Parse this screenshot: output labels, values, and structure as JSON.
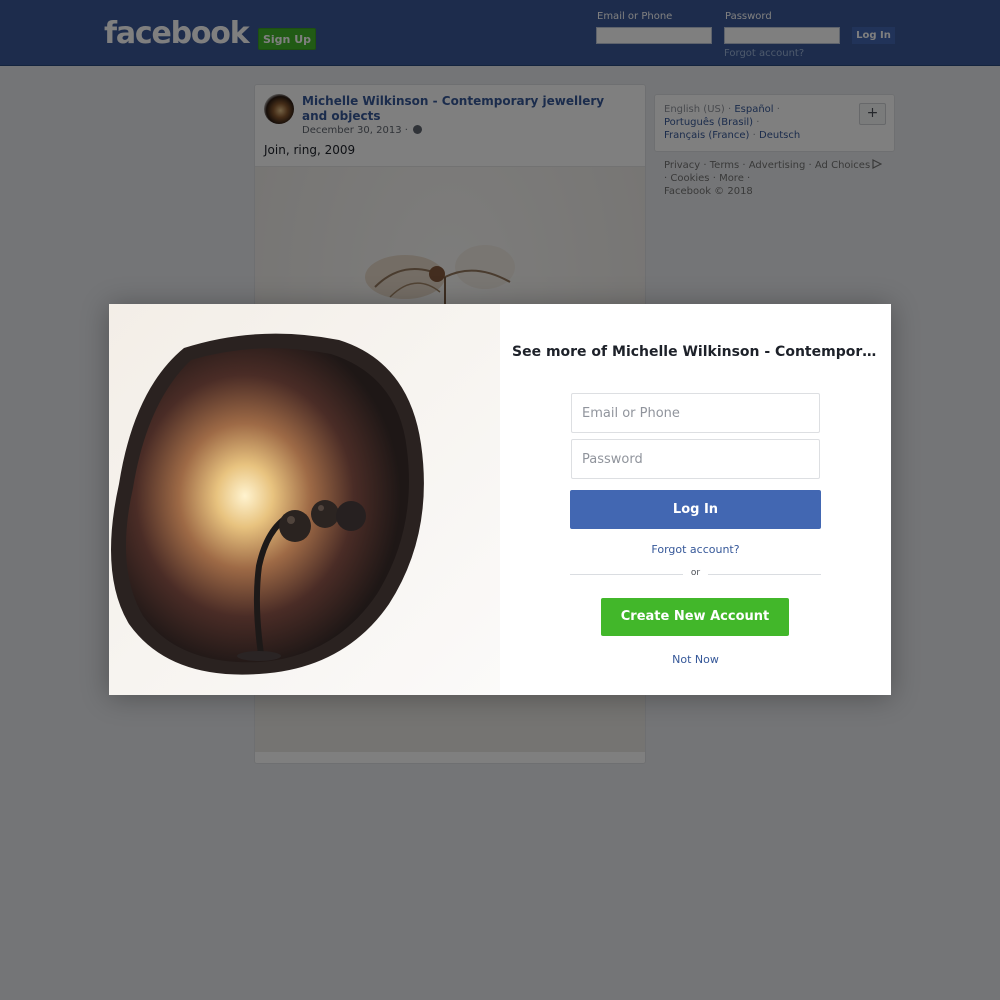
{
  "header": {
    "logo_text": "facebook",
    "signup_label": "Sign Up",
    "email_label": "Email or Phone",
    "password_label": "Password",
    "login_label": "Log In",
    "forgot_label": "Forgot account?"
  },
  "post": {
    "author": "Michelle Wilkinson - Contemporary jewellery and objects",
    "date": "December 30, 2013",
    "separator": " · ",
    "text": "Join, ring, 2009",
    "privacy_icon": "globe-icon"
  },
  "languages": {
    "current": "English (US)",
    "items": [
      "Español",
      "Português (Brasil)",
      "Français (France)",
      "Deutsch"
    ],
    "more_button": "+"
  },
  "footer": {
    "links": [
      "Privacy",
      "Terms",
      "Advertising",
      "Ad Choices",
      "Cookies",
      "More"
    ],
    "ad_choices_icon": "ad-choices-icon",
    "copyright": "Facebook © 2018"
  },
  "modal": {
    "title": "See more of Michelle Wilkinson - Contempor…",
    "email_placeholder": "Email or Phone",
    "password_placeholder": "Password",
    "login_label": "Log In",
    "forgot_label": "Forgot account?",
    "or_label": "or",
    "create_label": "Create New Account",
    "not_now_label": "Not Now"
  },
  "colors": {
    "brand_blue": "#3b5998",
    "button_blue": "#4267b2",
    "green": "#42b72a",
    "link": "#365899",
    "page_bg": "#e9ebee"
  }
}
